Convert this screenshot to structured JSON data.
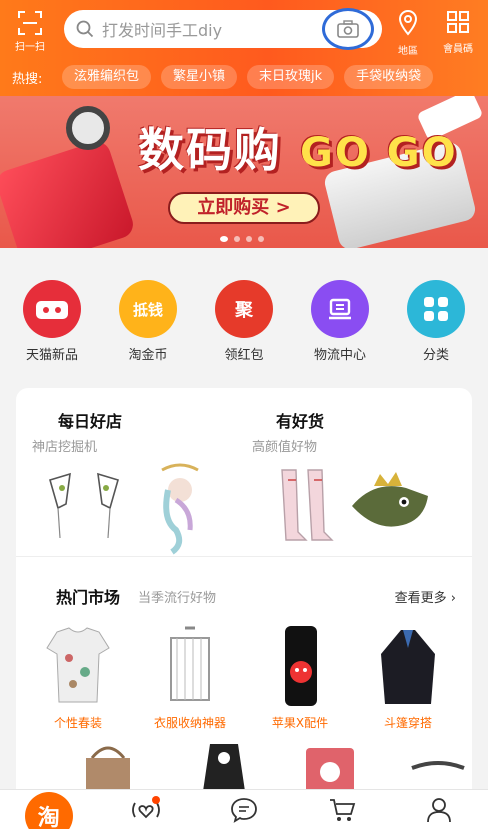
{
  "header": {
    "scan_label": "扫一扫",
    "search_placeholder": "打发时间手工diy",
    "location_label": "地區",
    "member_code_label": "會員碼",
    "hot_label": "热搜:",
    "hot_tags": [
      "泫雅编织包",
      "繁星小镇",
      "末日玫瑰jk",
      "手袋收纳袋"
    ]
  },
  "banner": {
    "title_main": "数码购",
    "title_go": "GO GO",
    "cta": "立即购买 >"
  },
  "shortcuts": [
    {
      "label": "天猫新品",
      "icon": "tmall-icon",
      "glyph": "••",
      "color": "#e62e3a"
    },
    {
      "label": "淘金币",
      "icon": "coin-icon",
      "glyph": "抵钱",
      "color": "#ffb31a"
    },
    {
      "label": "领红包",
      "icon": "red-packet-icon",
      "glyph": "聚",
      "color": "#e63a2a"
    },
    {
      "label": "物流中心",
      "icon": "logistics-icon",
      "glyph": "",
      "color": "#8a4df2"
    },
    {
      "label": "分类",
      "icon": "category-icon",
      "glyph": "",
      "color": "#2cb7d8"
    }
  ],
  "card": {
    "left_title": "每日好店",
    "left_sub": "神店挖掘机",
    "right_title": "有好货",
    "right_sub": "高颜值好物",
    "market_title": "热门市场",
    "market_sub": "当季流行好物",
    "more": "查看更多",
    "market_items": [
      "个性春装",
      "衣服收纳神器",
      "苹果X配件",
      "斗篷穿搭"
    ]
  },
  "tabbar": {
    "home_glyph": "淘"
  }
}
